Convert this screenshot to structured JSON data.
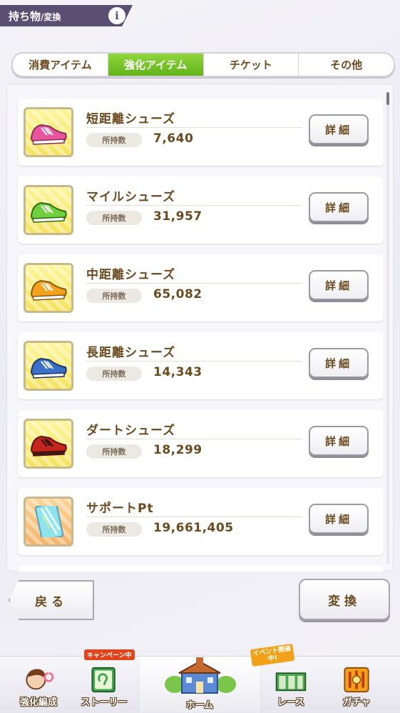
{
  "header": {
    "title_main": "持ち物",
    "title_sub": "/変換",
    "info_icon": "i"
  },
  "tabs": [
    {
      "label": "消費アイテム",
      "active": false
    },
    {
      "label": "強化アイテム",
      "active": true
    },
    {
      "label": "チケット",
      "active": false
    },
    {
      "label": "その他",
      "active": false
    }
  ],
  "items": [
    {
      "name": "短距離シューズ",
      "own_label": "所持数",
      "count": "7,640",
      "detail_label": "詳細",
      "color": "#e8559e"
    },
    {
      "name": "マイルシューズ",
      "own_label": "所持数",
      "count": "31,957",
      "detail_label": "詳細",
      "color": "#6fcf3c"
    },
    {
      "name": "中距離シューズ",
      "own_label": "所持数",
      "count": "65,082",
      "detail_label": "詳細",
      "color": "#f4a21c"
    },
    {
      "name": "長距離シューズ",
      "own_label": "所持数",
      "count": "14,343",
      "detail_label": "詳細",
      "color": "#3b70c9"
    },
    {
      "name": "ダートシューズ",
      "own_label": "所持数",
      "count": "18,299",
      "detail_label": "詳細",
      "color": "#c4261e"
    },
    {
      "name": "サポートPt",
      "own_label": "所持数",
      "count": "19,661,405",
      "detail_label": "詳細",
      "color": "#7fd6e8"
    }
  ],
  "buttons": {
    "back": "戻る",
    "convert": "変換"
  },
  "nav": {
    "campaign_badge": "キャンペーン中",
    "event_badge": "イベント開催中!",
    "items": [
      {
        "label": "強化編成"
      },
      {
        "label": "ストーリー"
      },
      {
        "label": "ホーム"
      },
      {
        "label": "レース"
      },
      {
        "label": "ガチャ"
      }
    ]
  }
}
